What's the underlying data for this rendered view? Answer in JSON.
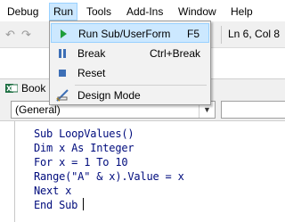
{
  "menubar": {
    "items": [
      "Debug",
      "Run",
      "Tools",
      "Add-Ins",
      "Window",
      "Help"
    ],
    "active": "Run"
  },
  "toolbar": {
    "cursor_position": "Ln 6, Col 8"
  },
  "project_window": {
    "title": "Book"
  },
  "code_window": {
    "object_combo": "(General)",
    "procedure_combo": "",
    "lines": [
      "Sub LoopValues()",
      "Dim x As Integer",
      "For x = 1 To 10",
      "Range(\"A\" & x).Value = x",
      "Next x",
      "End Sub"
    ]
  },
  "run_menu": {
    "items": [
      {
        "label": "Run Sub/UserForm",
        "shortcut": "F5",
        "icon": "play-icon",
        "highlighted": true
      },
      {
        "label": "Break",
        "shortcut": "Ctrl+Break",
        "icon": "pause-icon",
        "highlighted": false
      },
      {
        "label": "Reset",
        "shortcut": "",
        "icon": "stop-icon",
        "highlighted": false
      },
      {
        "label": "Design Mode",
        "shortcut": "",
        "icon": "design-mode-icon",
        "highlighted": false
      }
    ]
  },
  "colors": {
    "highlight": "#cce8ff",
    "highlight_border": "#99d1ff",
    "code_text": "#000c7d",
    "play_green": "#1e9e3a",
    "pause_blue": "#3d6fb6"
  }
}
